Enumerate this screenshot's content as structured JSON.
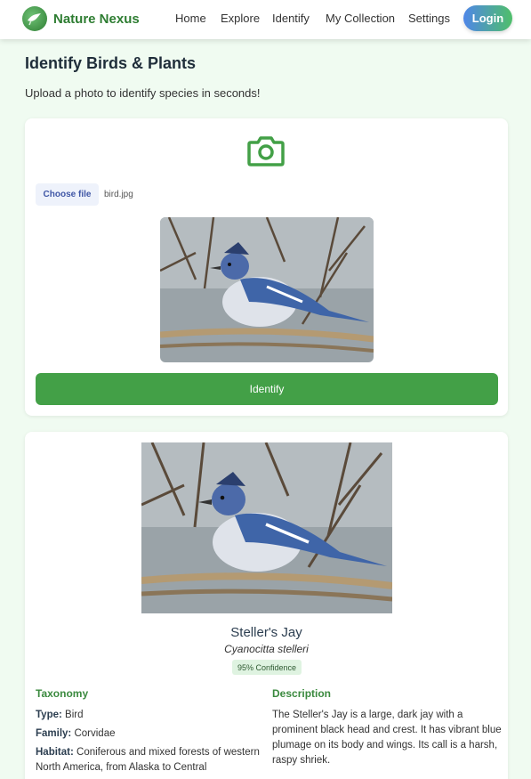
{
  "app": {
    "name": "Nature Nexus"
  },
  "nav": {
    "home": "Home",
    "explore": "Explore",
    "identify": "Identify",
    "collection": "My Collection",
    "settings": "Settings",
    "login": "Login"
  },
  "page": {
    "title": "Identify Birds & Plants",
    "subtitle": "Upload a photo to identify species in seconds!"
  },
  "upload": {
    "choose_label": "Choose file",
    "file_name": "bird.jpg",
    "identify_label": "Identify"
  },
  "result": {
    "common_name": "Steller's Jay",
    "scientific_name": "Cyanocitta stelleri",
    "confidence": "95% Confidence",
    "taxonomy_heading": "Taxonomy",
    "description_heading": "Description",
    "type_label": "Type:",
    "type_value": "Bird",
    "family_label": "Family:",
    "family_value": "Corvidae",
    "habitat_label": "Habitat:",
    "habitat_value": "Coniferous and mixed forests of western North America, from Alaska to Central",
    "description": "The Steller's Jay is a large, dark jay with a prominent black head and crest. It has vibrant blue plumage on its body and wings. Its call is a harsh, raspy shriek."
  },
  "colors": {
    "brand": "#2e7d32",
    "accent_green": "#43a047",
    "page_bg": "#f0fbf1",
    "section_heading": "#3b8a3f"
  },
  "icons": {
    "logo": "bird-logo-icon",
    "upload": "camera-icon"
  }
}
